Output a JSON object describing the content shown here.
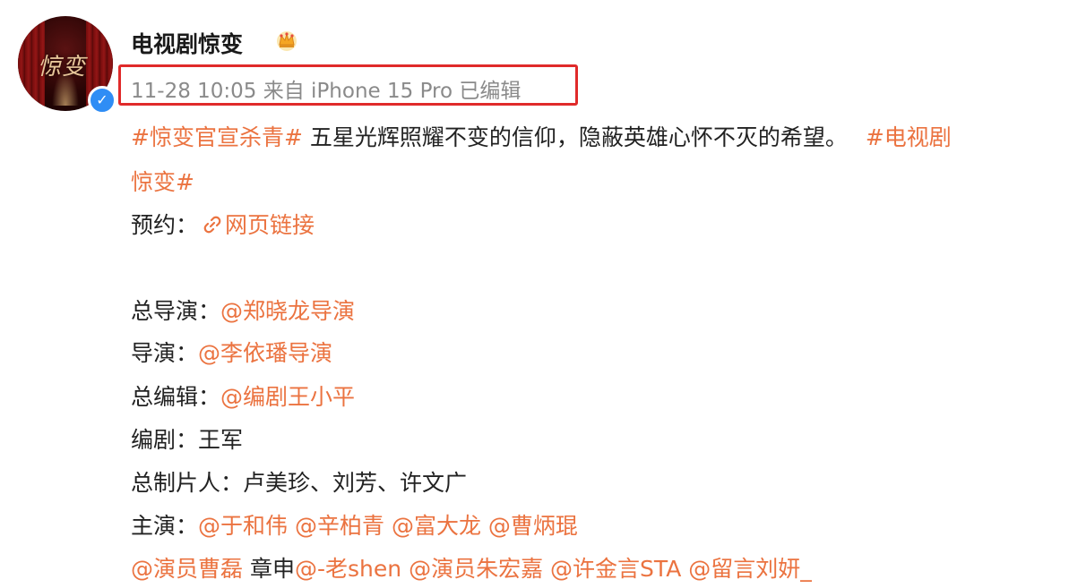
{
  "post": {
    "author_name": "电视剧惊变",
    "avatar_text": "惊变",
    "meta": "11-28 10:05 来自 iPhone 15 Pro 已编辑",
    "hashtag1": "#惊变官宣杀青#",
    "body_text": " 五星光辉照耀不变的信仰，隐蔽英雄心怀不灭的希望。",
    "hashtag2_part1": "#电视剧",
    "hashtag2_part2": "惊变#",
    "booking_label": "预约：",
    "booking_link": "网页链接",
    "chief_director_label": "总导演：",
    "chief_director_value": "@郑晓龙导演",
    "director_label": "导演：",
    "director_value": "@李依璠导演",
    "chief_editor_label": "总编辑：",
    "chief_editor_value": "@编剧王小平",
    "screenwriter_label": "编剧：",
    "screenwriter_value": "王军",
    "chief_producer_label": "总制片人：",
    "chief_producer_value": "卢美珍、刘芳、许文广",
    "cast_label": "主演：",
    "cast_mentions": [
      "@于和伟",
      "@辛柏青",
      "@富大龙",
      "@曹炳琨"
    ],
    "cast_line2": {
      "m1": "@演员曹磊",
      "plain": "章申",
      "m2": "@-老shen",
      "m3": "@演员朱宏嘉",
      "m4": "@许金言STA",
      "m5": "@留言刘妍_"
    }
  },
  "colors": {
    "link_orange": "#eb7340",
    "highlight_red": "#e02a2a",
    "verified_blue": "#2f8df5",
    "meta_gray": "#8a8a8a"
  },
  "icons": {
    "crown": "crown-icon",
    "verified": "verified-badge-icon",
    "link": "link-icon"
  }
}
